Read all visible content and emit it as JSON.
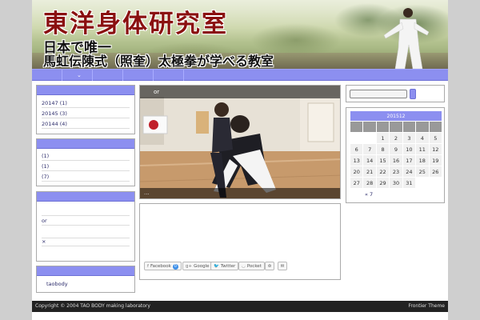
{
  "header": {
    "site_title": "東洋身体研究室",
    "tagline_line1": "日本で唯一",
    "tagline_line2": "馬虹伝陳式（照奎）太極拳が学べる教室"
  },
  "sidebar": {
    "archives": [
      "20147 (1)",
      "20145 (3)",
      "20144 (4)"
    ],
    "categories": [
      "(1)",
      "(1)",
      "(7)"
    ],
    "recent_items": [
      "or",
      "×"
    ],
    "tags_label": "taobody"
  },
  "slider": {
    "caption_title": "or",
    "caption_more": "..."
  },
  "share": {
    "facebook_label": "Facebook",
    "facebook_count": "0",
    "google_label": "Google",
    "twitter_label": "Twitter",
    "pocket_label": "Pocket"
  },
  "calendar": {
    "caption": "201512",
    "weeks": [
      [
        "",
        "",
        "1",
        "2",
        "3",
        "4",
        "5"
      ],
      [
        "6",
        "7",
        "8",
        "9",
        "10",
        "11",
        "12"
      ],
      [
        "13",
        "14",
        "15",
        "16",
        "17",
        "18",
        "19"
      ],
      [
        "20",
        "21",
        "22",
        "23",
        "24",
        "25",
        "26"
      ],
      [
        "27",
        "28",
        "29",
        "30",
        "31",
        "",
        ""
      ]
    ],
    "prev_link": "« 7"
  },
  "footer": {
    "copyright": "Copyright © 2004 TAO BODY making laboratory",
    "theme": "Frontier Theme"
  },
  "colors": {
    "accent": "#8c8ff0",
    "title_red": "#8a1010",
    "footer_bg": "#222222"
  }
}
